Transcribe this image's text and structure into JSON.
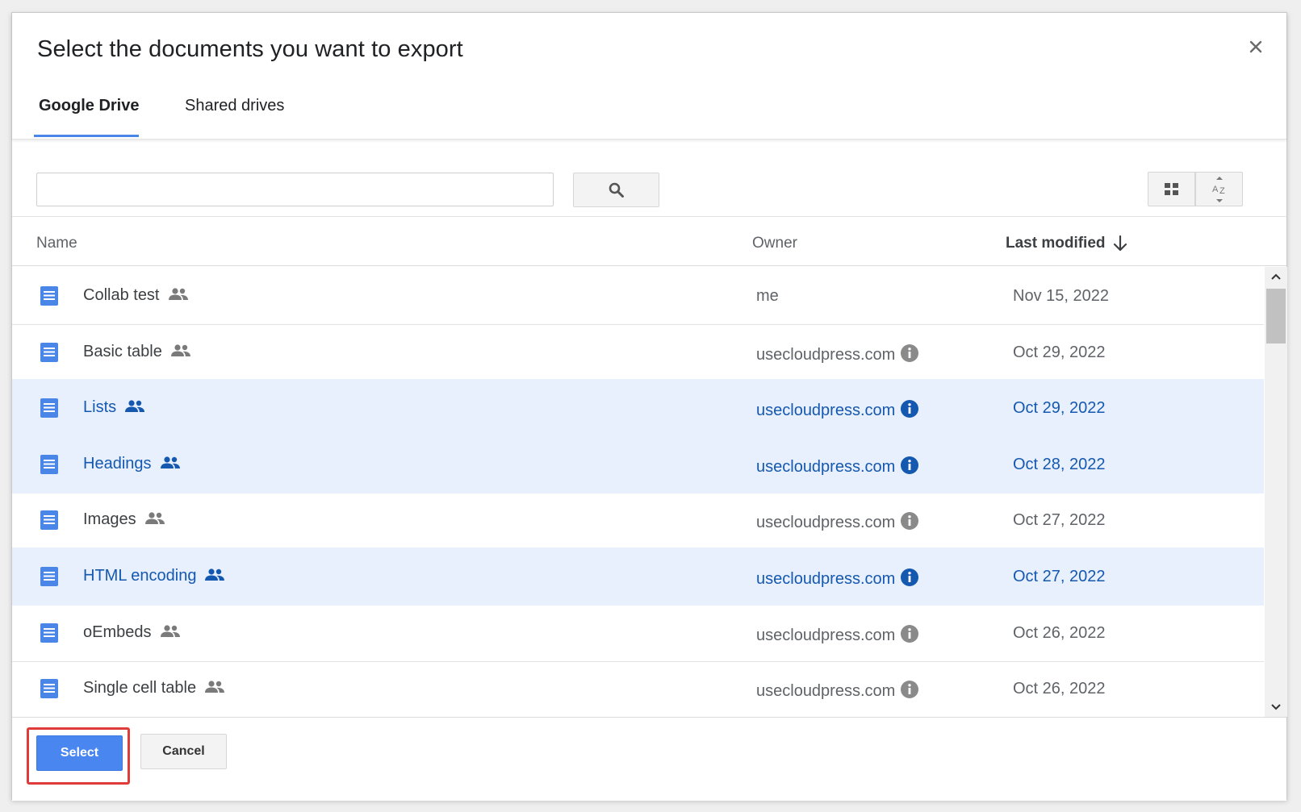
{
  "dialog": {
    "title": "Select the documents you want to export",
    "close_label": "×"
  },
  "tabs": [
    {
      "label": "Google Drive",
      "active": true
    },
    {
      "label": "Shared drives",
      "active": false
    }
  ],
  "search": {
    "value": "",
    "placeholder": ""
  },
  "columns": {
    "name": "Name",
    "owner": "Owner",
    "last_modified": "Last modified"
  },
  "rows": [
    {
      "name": "Collab test",
      "owner": "me",
      "date": "Nov 15, 2022",
      "selected": false,
      "show_info": false
    },
    {
      "name": "Basic table",
      "owner": "usecloudpress.com",
      "date": "Oct 29, 2022",
      "selected": false,
      "show_info": true
    },
    {
      "name": "Lists",
      "owner": "usecloudpress.com",
      "date": "Oct 29, 2022",
      "selected": true,
      "show_info": true
    },
    {
      "name": "Headings",
      "owner": "usecloudpress.com",
      "date": "Oct 28, 2022",
      "selected": true,
      "show_info": true
    },
    {
      "name": "Images",
      "owner": "usecloudpress.com",
      "date": "Oct 27, 2022",
      "selected": false,
      "show_info": true
    },
    {
      "name": "HTML encoding",
      "owner": "usecloudpress.com",
      "date": "Oct 27, 2022",
      "selected": true,
      "show_info": true
    },
    {
      "name": "oEmbeds",
      "owner": "usecloudpress.com",
      "date": "Oct 26, 2022",
      "selected": false,
      "show_info": true
    },
    {
      "name": "Single cell table",
      "owner": "usecloudpress.com",
      "date": "Oct 26, 2022",
      "selected": false,
      "show_info": true
    }
  ],
  "footer": {
    "select_label": "Select",
    "cancel_label": "Cancel"
  },
  "colors": {
    "accent": "#4a86f0",
    "selected_row_bg": "#e8f0fd",
    "selected_text": "#1558b0",
    "doc_icon": "#4a86e8",
    "highlight": "#e03b3b"
  },
  "icons": {
    "close": "close-icon",
    "search": "search-icon",
    "grid_view": "grid-view-icon",
    "sort_az": "sort-az-icon",
    "sort_arrow": "arrow-down-icon",
    "document": "google-doc-icon",
    "shared": "shared-people-icon",
    "info": "info-icon"
  }
}
